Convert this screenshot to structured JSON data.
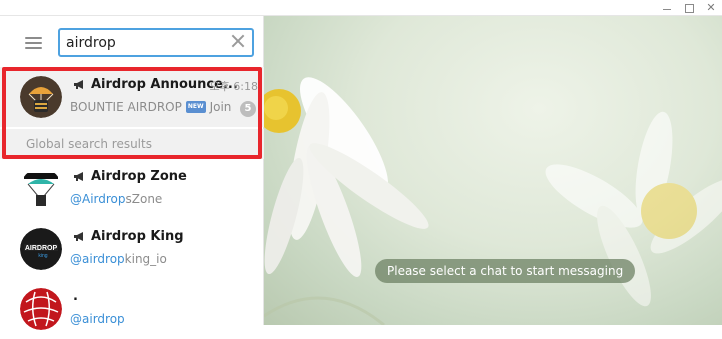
{
  "search": {
    "value": "airdrop"
  },
  "results": [
    {
      "name": "Airdrop Announce...",
      "time": "오후 6:18",
      "preview_sender": "BOUNTIE AIRDROP",
      "badge": "NEW",
      "preview_text": "Join h...",
      "unread": "5"
    }
  ],
  "global_label": "Global search results",
  "global_results": [
    {
      "name": "Airdrop Zone",
      "handle_match": "@Airdrop",
      "handle_rest": "sZone"
    },
    {
      "name": "Airdrop King",
      "handle_match": "@airdrop",
      "handle_rest": "king_io"
    },
    {
      "name": ".",
      "handle_match": "@airdrop",
      "handle_rest": ""
    }
  ],
  "chat_placeholder": "Please select a chat to start messaging",
  "colors": {
    "accent": "#4ea2e0",
    "highlight_frame": "#e8262c"
  }
}
